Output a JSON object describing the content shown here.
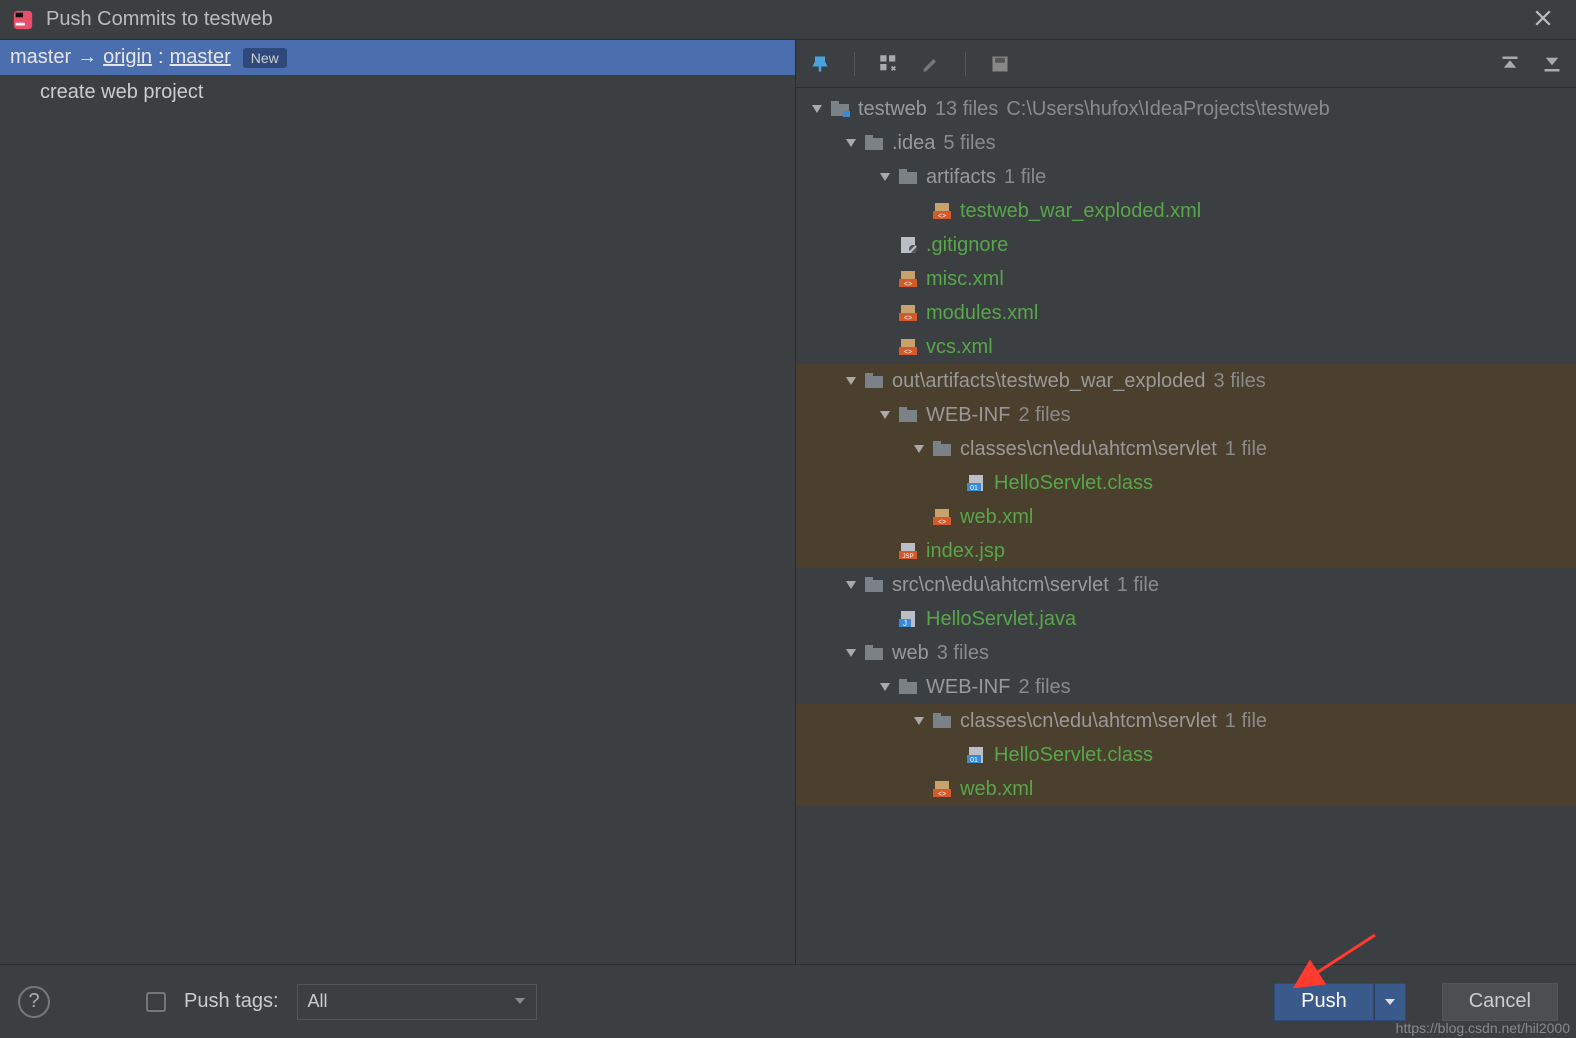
{
  "title": "Push Commits to testweb",
  "commit": {
    "local": "master",
    "arrow": "→",
    "remote_name": "origin",
    "colon": ":",
    "remote_branch": "master",
    "badge": "New",
    "items": [
      {
        "message": "create web project"
      }
    ]
  },
  "toolbar": {
    "buttons": [
      "pin",
      "group-by",
      "edit",
      "disk",
      "expand-all",
      "collapse-all"
    ]
  },
  "tree": [
    {
      "depth": 0,
      "expand": true,
      "arrow": true,
      "icon": "module",
      "name": "testweb",
      "nameClass": "gray",
      "count": "13 files",
      "path": "C:\\Users\\hufox\\IdeaProjects\\testweb",
      "sel": false
    },
    {
      "depth": 1,
      "expand": true,
      "arrow": true,
      "icon": "folder",
      "name": ".idea",
      "nameClass": "gray",
      "count": "5 files",
      "sel": false
    },
    {
      "depth": 2,
      "expand": true,
      "arrow": true,
      "icon": "folder",
      "name": "artifacts",
      "nameClass": "gray",
      "count": "1 file",
      "sel": false
    },
    {
      "depth": 3,
      "expand": false,
      "arrow": false,
      "icon": "xml",
      "name": "testweb_war_exploded.xml",
      "nameClass": "green",
      "sel": false
    },
    {
      "depth": 2,
      "expand": false,
      "arrow": false,
      "icon": "file",
      "name": ".gitignore",
      "nameClass": "green",
      "sel": false
    },
    {
      "depth": 2,
      "expand": false,
      "arrow": false,
      "icon": "xml",
      "name": "misc.xml",
      "nameClass": "green",
      "sel": false
    },
    {
      "depth": 2,
      "expand": false,
      "arrow": false,
      "icon": "xml",
      "name": "modules.xml",
      "nameClass": "green",
      "sel": false
    },
    {
      "depth": 2,
      "expand": false,
      "arrow": false,
      "icon": "xml",
      "name": "vcs.xml",
      "nameClass": "green",
      "sel": false
    },
    {
      "depth": 1,
      "expand": true,
      "arrow": true,
      "icon": "folder",
      "name": "out\\artifacts\\testweb_war_exploded",
      "nameClass": "gray",
      "count": "3 files",
      "sel": true
    },
    {
      "depth": 2,
      "expand": true,
      "arrow": true,
      "icon": "folder",
      "name": "WEB-INF",
      "nameClass": "gray",
      "count": "2 files",
      "sel": true
    },
    {
      "depth": 3,
      "expand": true,
      "arrow": true,
      "icon": "folder",
      "name": "classes\\cn\\edu\\ahtcm\\servlet",
      "nameClass": "gray",
      "count": "1 file",
      "sel": true
    },
    {
      "depth": 4,
      "expand": false,
      "arrow": false,
      "icon": "class",
      "name": "HelloServlet.class",
      "nameClass": "green",
      "sel": true
    },
    {
      "depth": 3,
      "expand": false,
      "arrow": false,
      "icon": "xml",
      "name": "web.xml",
      "nameClass": "green",
      "sel": true
    },
    {
      "depth": 2,
      "expand": false,
      "arrow": false,
      "icon": "jsp",
      "name": "index.jsp",
      "nameClass": "green",
      "sel": true
    },
    {
      "depth": 1,
      "expand": true,
      "arrow": true,
      "icon": "folder",
      "name": "src\\cn\\edu\\ahtcm\\servlet",
      "nameClass": "gray",
      "count": "1 file",
      "sel": false
    },
    {
      "depth": 2,
      "expand": false,
      "arrow": false,
      "icon": "java",
      "name": "HelloServlet.java",
      "nameClass": "green",
      "sel": false
    },
    {
      "depth": 1,
      "expand": true,
      "arrow": true,
      "icon": "folder",
      "name": "web",
      "nameClass": "gray",
      "count": "3 files",
      "sel": false
    },
    {
      "depth": 2,
      "expand": true,
      "arrow": true,
      "icon": "folder",
      "name": "WEB-INF",
      "nameClass": "gray",
      "count": "2 files",
      "sel": false
    },
    {
      "depth": 3,
      "expand": true,
      "arrow": true,
      "icon": "folder",
      "name": "classes\\cn\\edu\\ahtcm\\servlet",
      "nameClass": "gray",
      "count": "1 file",
      "sel": true
    },
    {
      "depth": 4,
      "expand": false,
      "arrow": false,
      "icon": "class",
      "name": "HelloServlet.class",
      "nameClass": "green",
      "sel": true
    },
    {
      "depth": 3,
      "expand": false,
      "arrow": false,
      "icon": "xml",
      "name": "web.xml",
      "nameClass": "green",
      "sel": true
    }
  ],
  "footer": {
    "help": "?",
    "pushtags_label": "Push tags:",
    "pushtags_combo": "All",
    "push": "Push",
    "cancel": "Cancel"
  },
  "watermark": "https://blog.csdn.net/hil2000"
}
